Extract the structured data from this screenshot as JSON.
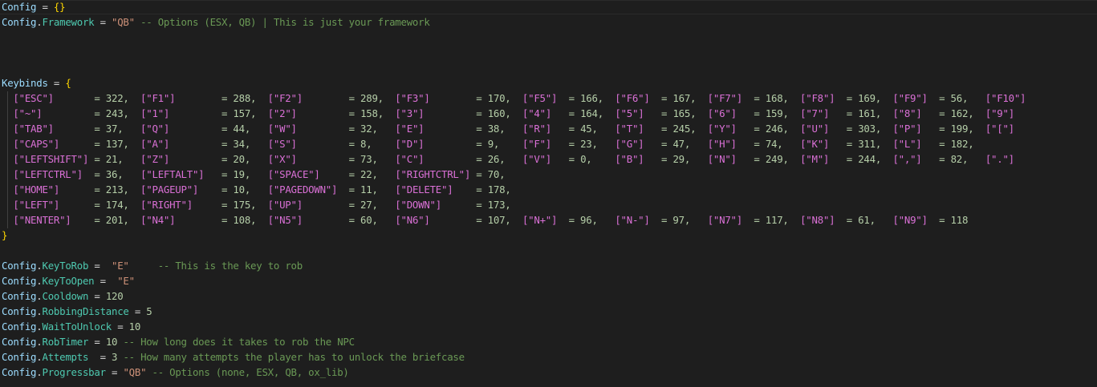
{
  "config_line": {
    "var": "Config",
    "op": " = ",
    "braces": "{}"
  },
  "framework_line": {
    "var": "Config",
    "dot": ".",
    "prop": "Framework",
    "op": " = ",
    "value": "\"QB\"",
    "comment": " -- Options (ESX, QB) | This is just your framework"
  },
  "keybinds_header": {
    "var": "Keybinds",
    "op": " = ",
    "brace": "{"
  },
  "keybinds_rows": [
    [
      [
        "[\"ESC\"]",
        "       = 322,  "
      ],
      [
        "[\"F1\"]",
        "        = 288,  "
      ],
      [
        "[\"F2\"]",
        "        = 289,  "
      ],
      [
        "[\"F3\"]",
        "        = 170,  "
      ],
      [
        "[\"F5\"]",
        "  = 166,  "
      ],
      [
        "[\"F6\"]",
        "  = 167,  "
      ],
      [
        "[\"F7\"]",
        "  = 168,  "
      ],
      [
        "[\"F8\"]",
        "  = 169,  "
      ],
      [
        "[\"F9\"]",
        "  = 56,   "
      ],
      [
        "[\"F10\"]",
        ""
      ]
    ],
    [
      [
        "[\"~\"]",
        "         = 243,  "
      ],
      [
        "[\"1\"]",
        "         = 157,  "
      ],
      [
        "[\"2\"]",
        "         = 158,  "
      ],
      [
        "[\"3\"]",
        "         = 160,  "
      ],
      [
        "[\"4\"]",
        "   = 164,  "
      ],
      [
        "[\"5\"]",
        "   = 165,  "
      ],
      [
        "[\"6\"]",
        "   = 159,  "
      ],
      [
        "[\"7\"]",
        "   = 161,  "
      ],
      [
        "[\"8\"]",
        "   = 162,  "
      ],
      [
        "[\"9\"]",
        ""
      ]
    ],
    [
      [
        "[\"TAB\"]",
        "       = 37,   "
      ],
      [
        "[\"Q\"]",
        "         = 44,   "
      ],
      [
        "[\"W\"]",
        "         = 32,   "
      ],
      [
        "[\"E\"]",
        "         = 38,   "
      ],
      [
        "[\"R\"]",
        "   = 45,   "
      ],
      [
        "[\"T\"]",
        "   = 245,  "
      ],
      [
        "[\"Y\"]",
        "   = 246,  "
      ],
      [
        "[\"U\"]",
        "   = 303,  "
      ],
      [
        "[\"P\"]",
        "   = 199,  "
      ],
      [
        "[\"[\"]",
        ""
      ]
    ],
    [
      [
        "[\"CAPS\"]",
        "      = 137,  "
      ],
      [
        "[\"A\"]",
        "         = 34,   "
      ],
      [
        "[\"S\"]",
        "         = 8,    "
      ],
      [
        "[\"D\"]",
        "         = 9,    "
      ],
      [
        "[\"F\"]",
        "   = 23,   "
      ],
      [
        "[\"G\"]",
        "   = 47,   "
      ],
      [
        "[\"H\"]",
        "   = 74,   "
      ],
      [
        "[\"K\"]",
        "   = 311,  "
      ],
      [
        "[\"L\"]",
        "   = 182,"
      ]
    ],
    [
      [
        "[\"LEFTSHIFT\"]",
        " = 21,   "
      ],
      [
        "[\"Z\"]",
        "         = 20,   "
      ],
      [
        "[\"X\"]",
        "         = 73,   "
      ],
      [
        "[\"C\"]",
        "         = 26,   "
      ],
      [
        "[\"V\"]",
        "   = 0,    "
      ],
      [
        "[\"B\"]",
        "   = 29,   "
      ],
      [
        "[\"N\"]",
        "   = 249,  "
      ],
      [
        "[\"M\"]",
        "   = 244,  "
      ],
      [
        "[\",\"]",
        "   = 82,   "
      ],
      [
        "[\".\"]",
        ""
      ]
    ],
    [
      [
        "[\"LEFTCTRL\"]",
        "  = 36,   "
      ],
      [
        "[\"LEFTALT\"]",
        "   = 19,   "
      ],
      [
        "[\"SPACE\"]",
        "     = 22,   "
      ],
      [
        "[\"RIGHTCTRL\"]",
        " = 70,"
      ]
    ],
    [
      [
        "[\"HOME\"]",
        "      = 213,  "
      ],
      [
        "[\"PAGEUP\"]",
        "    = 10,   "
      ],
      [
        "[\"PAGEDOWN\"]",
        "  = 11,   "
      ],
      [
        "[\"DELETE\"]",
        "    = 178,"
      ]
    ],
    [
      [
        "[\"LEFT\"]",
        "      = 174,  "
      ],
      [
        "[\"RIGHT\"]",
        "     = 175,  "
      ],
      [
        "[\"UP\"]",
        "        = 27,   "
      ],
      [
        "[\"DOWN\"]",
        "      = 173,"
      ]
    ],
    [
      [
        "[\"NENTER\"]",
        "    = 201,  "
      ],
      [
        "[\"N4\"]",
        "        = 108,  "
      ],
      [
        "[\"N5\"]",
        "        = 60,   "
      ],
      [
        "[\"N6\"]",
        "        = 107,  "
      ],
      [
        "[\"N+\"]",
        "  = 96,   "
      ],
      [
        "[\"N-\"]",
        "  = 97,   "
      ],
      [
        "[\"N7\"]",
        "  = 117,  "
      ],
      [
        "[\"N8\"]",
        "  = 61,   "
      ],
      [
        "[\"N9\"]",
        "  = 118"
      ]
    ]
  ],
  "keybinds_close": "}",
  "settings": [
    {
      "var": "Config",
      "dot": ".",
      "prop": "KeyToRob",
      "op": " =  ",
      "value": "\"E\"",
      "comment": "     -- This is the key to rob"
    },
    {
      "var": "Config",
      "dot": ".",
      "prop": "KeyToOpen",
      "op": " =  ",
      "value": "\"E\"",
      "comment": ""
    },
    {
      "var": "Config",
      "dot": ".",
      "prop": "Cooldown",
      "op": " = ",
      "value": "120",
      "comment": ""
    },
    {
      "var": "Config",
      "dot": ".",
      "prop": "RobbingDistance",
      "op": " = ",
      "value": "5",
      "comment": ""
    },
    {
      "var": "Config",
      "dot": ".",
      "prop": "WaitToUnlock",
      "op": " = ",
      "value": "10",
      "comment": ""
    },
    {
      "var": "Config",
      "dot": ".",
      "prop": "RobTimer",
      "op": " = ",
      "value": "10",
      "comment": " -- How long does it takes to rob the NPC"
    },
    {
      "var": "Config",
      "dot": ".",
      "prop": "Attempts",
      "op": "  = ",
      "value": "3",
      "comment": " -- How many attempts the player has to unlock the briefcase"
    },
    {
      "var": "Config",
      "dot": ".",
      "prop": "Progressbar",
      "op": " = ",
      "value": "\"QB\"",
      "comment": " -- Options (none, ESX, QB, ox_lib)"
    }
  ],
  "colors": {
    "background": "#1e1e1e",
    "variable": "#9cdcfe",
    "property": "#4ec9b0",
    "string": "#ce9178",
    "comment": "#6a9955",
    "number": "#b5cea8",
    "brace_outer": "#ffd700",
    "bracket_key": "#da70d6"
  }
}
